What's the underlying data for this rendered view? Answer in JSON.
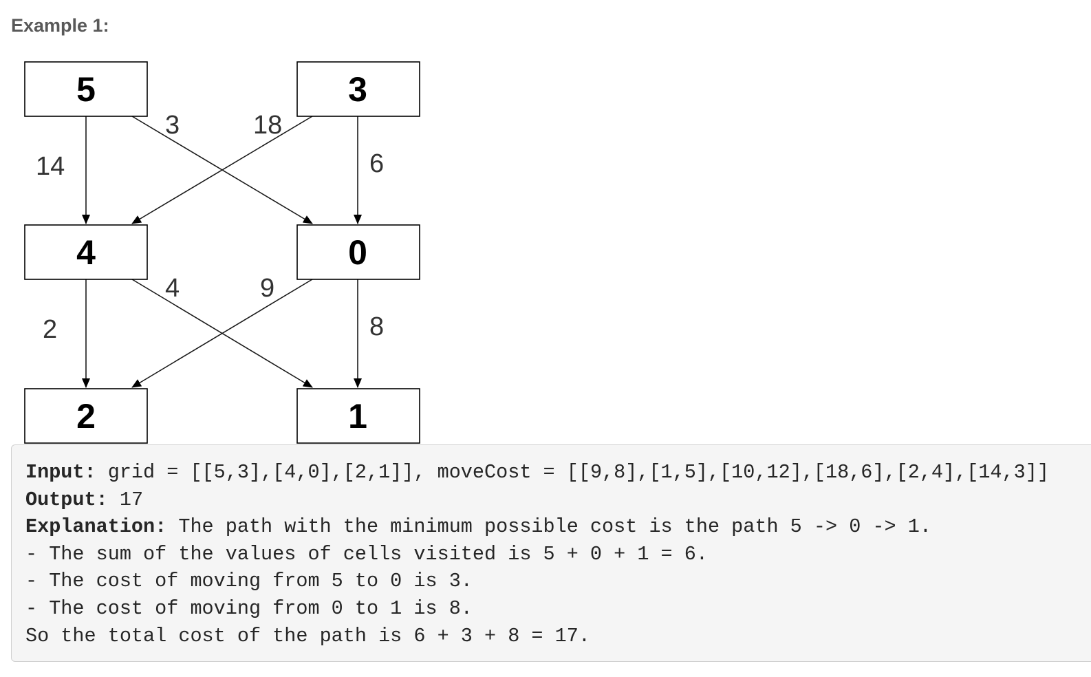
{
  "heading": "Example 1:",
  "diagram": {
    "nodes": [
      {
        "id": "r0c0",
        "label": "5"
      },
      {
        "id": "r0c1",
        "label": "3"
      },
      {
        "id": "r1c0",
        "label": "4"
      },
      {
        "id": "r1c1",
        "label": "0"
      },
      {
        "id": "r2c0",
        "label": "2"
      },
      {
        "id": "r2c1",
        "label": "1"
      }
    ],
    "edges": [
      {
        "from": "5",
        "to": "4",
        "cost": "14"
      },
      {
        "from": "5",
        "to": "0",
        "cost": "3"
      },
      {
        "from": "3",
        "to": "4",
        "cost": "18"
      },
      {
        "from": "3",
        "to": "0",
        "cost": "6"
      },
      {
        "from": "4",
        "to": "2",
        "cost": "2"
      },
      {
        "from": "4",
        "to": "1",
        "cost": "4"
      },
      {
        "from": "0",
        "to": "2",
        "cost": "9"
      },
      {
        "from": "0",
        "to": "1",
        "cost": "8"
      }
    ]
  },
  "example": {
    "input_label": "Input:",
    "input_text": " grid = [[5,3],[4,0],[2,1]], moveCost = [[9,8],[1,5],[10,12],[18,6],[2,4],[14,3]]",
    "output_label": "Output:",
    "output_text": " 17",
    "explanation_label": "Explanation:",
    "explanation_text": " The path with the minimum possible cost is the path 5 -> 0 -> 1.",
    "detail_lines": [
      "- The sum of the values of cells visited is 5 + 0 + 1 = 6.",
      "- The cost of moving from 5 to 0 is 3.",
      "- The cost of moving from 0 to 1 is 8.",
      "So the total cost of the path is 6 + 3 + 8 = 17."
    ]
  }
}
